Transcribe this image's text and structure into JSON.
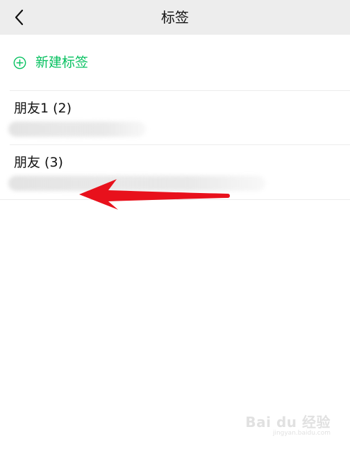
{
  "navbar": {
    "back_icon": "chevron-left-icon",
    "title": "标签"
  },
  "new_tag": {
    "icon": "plus-circle-icon",
    "label": "新建标签"
  },
  "tags": [
    {
      "name": "朋友1 (2)"
    },
    {
      "name": "朋友 (3)"
    }
  ],
  "annotation": {
    "icon": "red-arrow-left-icon",
    "color": "#e8111c"
  },
  "watermark": {
    "logo": "Bai du 经验",
    "sub": "jingyan.baidu.com"
  },
  "colors": {
    "accent": "#07c160",
    "navbar_bg": "#ededed"
  }
}
